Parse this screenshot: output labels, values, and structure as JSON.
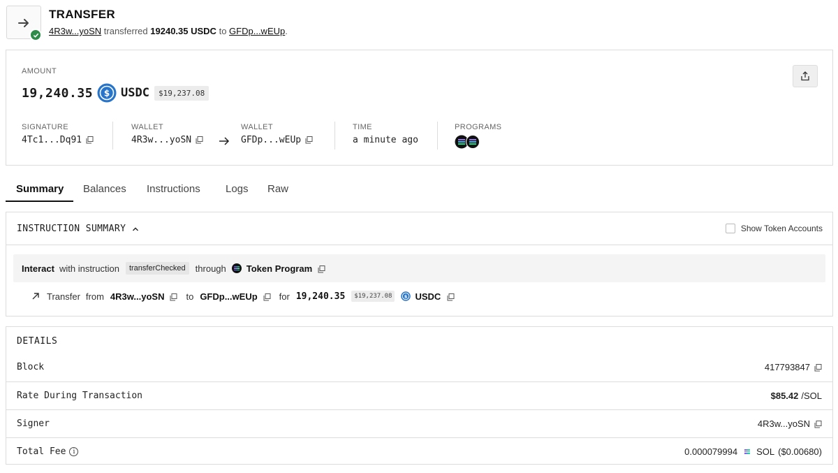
{
  "header": {
    "title": "TRANSFER",
    "from_short": "4R3w...yoSN",
    "verb": "transferred",
    "amount_text": "19240.35 USDC",
    "to_word": "to",
    "to_short": "GFDp...wEUp",
    "period": "."
  },
  "amount": {
    "label": "AMOUNT",
    "value": "19,240.35",
    "symbol": "USDC",
    "usd": "$19,237.08"
  },
  "meta": {
    "signature_label": "SIGNATURE",
    "signature": "4Tc1...Dq91",
    "wallet_from_label": "WALLET",
    "wallet_from": "4R3w...yoSN",
    "wallet_to_label": "WALLET",
    "wallet_to": "GFDp...wEUp",
    "time_label": "TIME",
    "time": "a minute ago",
    "programs_label": "PROGRAMS"
  },
  "tabs": [
    {
      "label": "Summary",
      "active": true
    },
    {
      "label": "Balances",
      "active": false
    },
    {
      "label": "Instructions",
      "active": false
    },
    {
      "label": "Logs",
      "active": false
    },
    {
      "label": "Raw",
      "active": false
    }
  ],
  "instruction_summary": {
    "title": "INSTRUCTION SUMMARY",
    "show_token_accounts": "Show Token Accounts",
    "interact": "Interact",
    "with_instruction": "with instruction",
    "instruction": "transferChecked",
    "through": "through",
    "program": "Token Program",
    "transfer": {
      "verb": "Transfer",
      "from_word": "from",
      "from": "4R3w...yoSN",
      "to_word": "to",
      "to": "GFDp...wEUp",
      "for_word": "for",
      "amount": "19,240.35",
      "usd": "$19,237.08",
      "symbol": "USDC"
    }
  },
  "details": {
    "title": "DETAILS",
    "rows": [
      {
        "key": "Block",
        "value": "417793847"
      },
      {
        "key": "Rate During Transaction",
        "value": "$85.42",
        "unit": "/SOL"
      },
      {
        "key": "Signer",
        "value": "4R3w...yoSN"
      },
      {
        "key": "Total Fee",
        "value": "0.000079994",
        "unit": "SOL",
        "usd": "($0.00680)"
      }
    ]
  },
  "colors": {
    "success": "#2e8b4a",
    "usdc_blue": "#2775ca",
    "text": "#1a1a1a",
    "border": "#dcdcdc"
  }
}
